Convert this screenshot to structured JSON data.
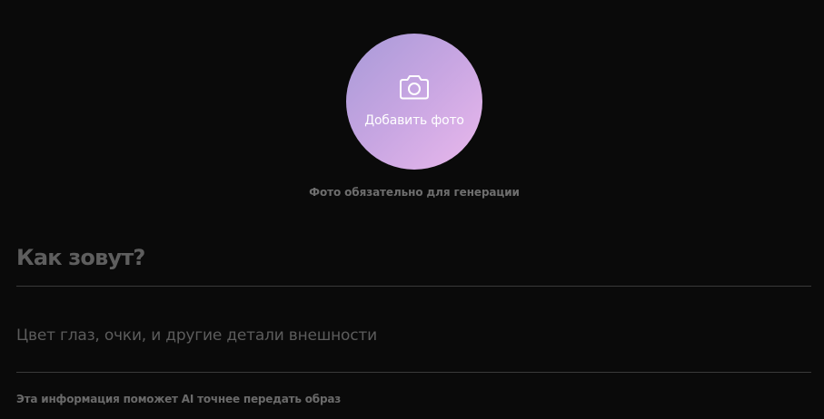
{
  "photo": {
    "icon": "camera-icon",
    "label": "Добавить фото",
    "hint": "Фото обязательно для генерации",
    "gradient": [
      "#a89ad8",
      "#eab8ec"
    ]
  },
  "name_field": {
    "placeholder": "Как зовут?",
    "value": ""
  },
  "details_field": {
    "placeholder": "Цвет глаз, очки, и другие детали внешности",
    "value": "",
    "hint": "Эта информация поможет AI точнее передать образ"
  },
  "colors": {
    "background": "#0a0a0a",
    "divider": "#3a3a3a",
    "hint_text": "#6e6e6e"
  }
}
